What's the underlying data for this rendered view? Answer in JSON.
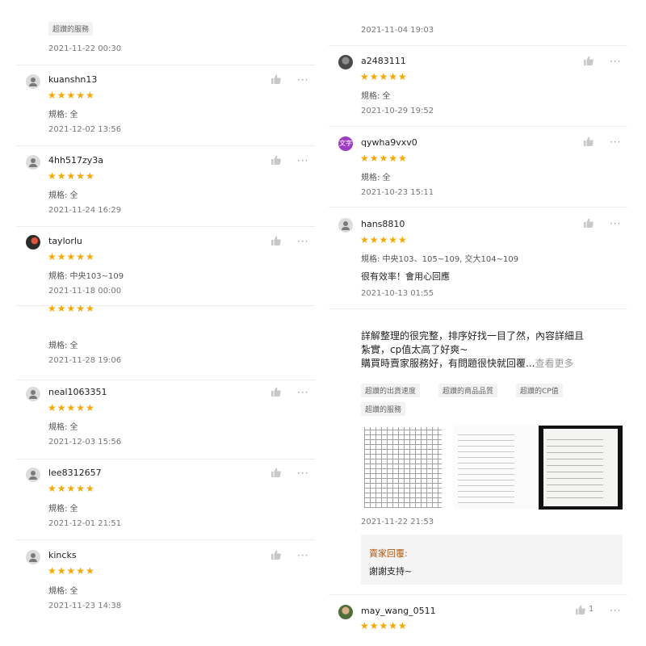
{
  "left_column": {
    "partial_top": {
      "tag": "超讚的服務",
      "date": "2021-11-22 00:30"
    },
    "reviews": [
      {
        "username": "kuanshn13",
        "stars": "★★★★★",
        "spec": "規格: 全",
        "date": "2021-12-02 13:56"
      },
      {
        "username": "4hh517zy3a",
        "stars": "★★★★★",
        "spec": "規格: 全",
        "date": "2021-11-24 16:29"
      },
      {
        "username": "taylorlu",
        "stars": "★★★★★",
        "spec": "規格: 中央103~109",
        "date": "2021-11-18 00:00"
      },
      {
        "username": "",
        "stars": "★★★★★",
        "spec": "規格: 全",
        "date": "2021-11-28 19:06"
      },
      {
        "username": "neal1063351",
        "stars": "★★★★★",
        "spec": "規格: 全",
        "date": "2021-12-03 15:56"
      },
      {
        "username": "lee8312657",
        "stars": "★★★★★",
        "spec": "規格: 全",
        "date": "2021-12-01 21:51"
      },
      {
        "username": "kincks",
        "stars": "★★★★★",
        "spec": "規格: 全",
        "date": "2021-11-23 14:38"
      }
    ]
  },
  "right_column": {
    "partial_top": {
      "date": "2021-11-04 19:03"
    },
    "reviews": [
      {
        "username": "a2483111",
        "stars": "★★★★★",
        "spec": "規格: 全",
        "date": "2021-10-29 19:52"
      },
      {
        "username": "qywha9vxv0",
        "avatar_text": "文字",
        "stars": "★★★★★",
        "spec": "規格: 全",
        "date": "2021-10-23 15:11"
      },
      {
        "username": "hans8810",
        "stars": "★★★★★",
        "spec": "規格: 中央103、105~109, 交大104~109",
        "comment": "很有效率！會用心回應",
        "date": "2021-10-13 01:55"
      }
    ],
    "long_review": {
      "text_line1": "詳解整理的很完整，排序好找一目了然，內容詳細且",
      "text_line2": "紮實，cp值太高了好爽~",
      "text_line3": "購買時賣家服務好，有問題很快就回覆...",
      "see_more": "查看更多",
      "tags": [
        "超讚的出貨速度",
        "超讚的商品品質",
        "超讚的CP值",
        "超讚的服務"
      ],
      "date": "2021-11-22 21:53",
      "seller_reply_label": "賣家回覆:",
      "seller_reply_text": "謝謝支持~"
    },
    "bottom_review": {
      "username": "may_wang_0511",
      "stars": "★★★★★",
      "like_count": "1"
    }
  },
  "colors": {
    "star": "#f6a700",
    "reply_label": "#b05a16",
    "tag_bg": "#f2f2f2",
    "divider": "#ececec"
  },
  "icons": {
    "like": "thumbs-up-icon",
    "more": "more-options-icon",
    "avatar": "default-avatar-icon"
  }
}
